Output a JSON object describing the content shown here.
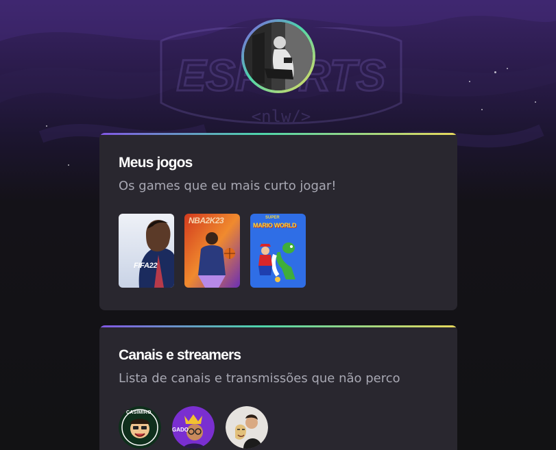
{
  "profile": {
    "avatar_icon": "profile-photo"
  },
  "background": {
    "watermark_text": "ESPORTS",
    "watermark_sub": "<nlw/>"
  },
  "games_section": {
    "title": "Meus jogos",
    "subtitle": "Os games que eu mais curto jogar!",
    "games": [
      {
        "name": "FIFA 22",
        "cover_text": "FIFA22"
      },
      {
        "name": "NBA 2K23",
        "cover_text": "NBA2K23"
      },
      {
        "name": "Super Mario World",
        "cover_text_top": "SUPER",
        "cover_text": "MARIO WORLD"
      }
    ]
  },
  "streamers_section": {
    "title": "Canais e streamers",
    "subtitle": "Lista de canais e transmissões que não perco",
    "streamers": [
      {
        "badge_text": "CASIMIRO"
      },
      {
        "badge_text": "GADO"
      },
      {
        "badge_text": ""
      }
    ]
  },
  "colors": {
    "accent_purple": "#8257e5",
    "accent_green": "#4ed5ab",
    "accent_yellow": "#e8d95c",
    "card_bg": "#29272f",
    "subtitle": "#a8a8b3"
  }
}
